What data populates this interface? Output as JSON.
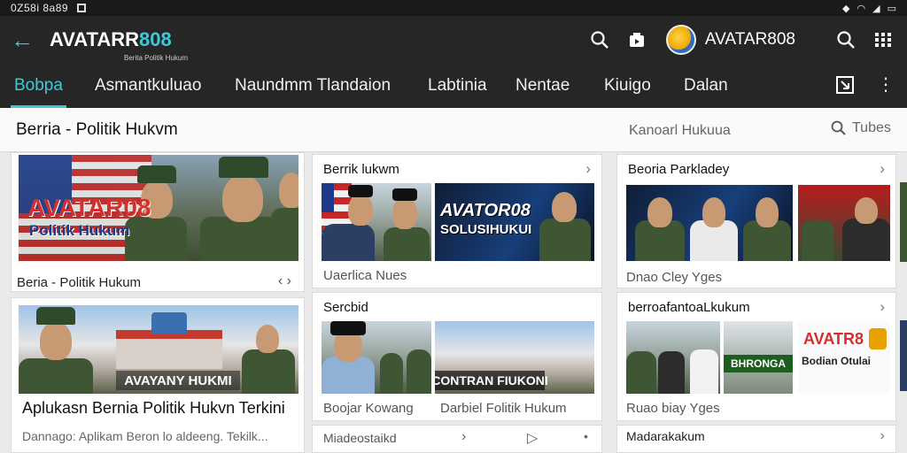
{
  "status": {
    "time": "0Z58i 8a89",
    "battery_label": ""
  },
  "appbar": {
    "brand_main": "AVATARR",
    "brand_num": "808",
    "brand_sub": "Berita Politik Hukum",
    "profile_name": "AVATAR808"
  },
  "tabs": [
    "Bobpa",
    "Asmantkuluao",
    "Naundmm Tlandaion",
    "Labtinia",
    "Nentae",
    "Kiuigo",
    "Dalan"
  ],
  "subheader": {
    "title": "Berria - Politik Hukvm",
    "sort_label": "Kanoarl Hukuua",
    "filter_label": "Tubes"
  },
  "cards": {
    "hero": {
      "overlay_title": "AVATAR08",
      "overlay_sub": "Politik Hukum",
      "caption": "Beria - Politik Hukum"
    },
    "featured": {
      "banner": "AVAYANY HUKMI",
      "title": "Aplukasn Bernia Politik Hukvn Terkini",
      "desc": "Dannago: Aplikam Beron lo aldeeng. Tekilk..."
    },
    "mid_top": {
      "heading": "Berrik lukwm",
      "overlay": "AVATOR08",
      "overlay_sub": "SOLUSIHUKUI",
      "caption": "Uaerlica Nues"
    },
    "mid_bottom": {
      "heading": "Sercbid",
      "banner": "CONTRAN FIUKONI",
      "caption_left": "Boojar Kowang",
      "caption_right": "Darbiel Folitik Hukum"
    },
    "mid_footer": {
      "label": "Miadeostaikd"
    },
    "right_top": {
      "heading": "Beoria Parkladey",
      "caption": "Dnao Cley Yges"
    },
    "right_bottom": {
      "heading": "berroafantoaLkukum",
      "logo_text": "AVATR8",
      "logo_sub": "Bodian Otulai",
      "banner_left": "BHRONGA",
      "caption": "Ruao biay Yges"
    },
    "right_footer": {
      "label": "Madarakakum"
    }
  }
}
